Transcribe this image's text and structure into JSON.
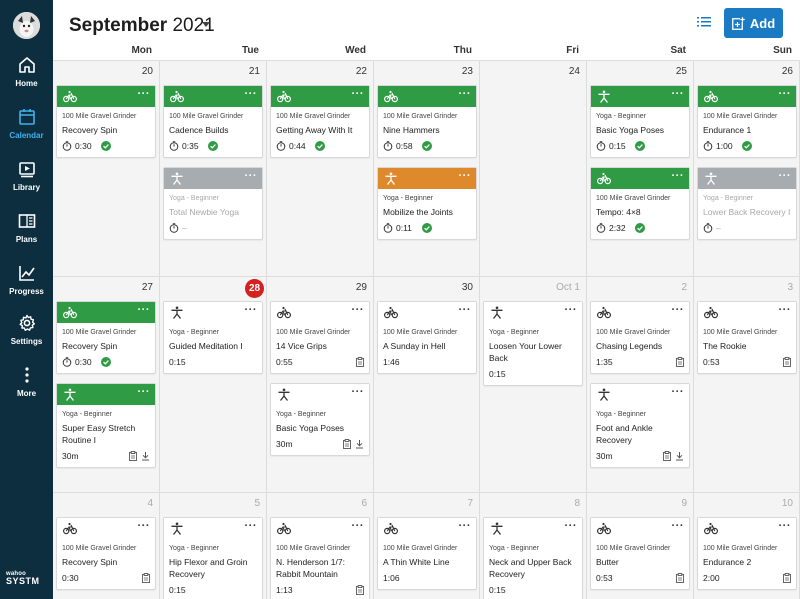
{
  "sidebar": {
    "nav": [
      {
        "label": "Home",
        "icon": "home-icon",
        "active": false
      },
      {
        "label": "Calendar",
        "icon": "calendar-icon",
        "active": true
      },
      {
        "label": "Library",
        "icon": "library-icon",
        "active": false
      },
      {
        "label": "Plans",
        "icon": "plans-icon",
        "active": false
      },
      {
        "label": "Progress",
        "icon": "progress-icon",
        "active": false
      },
      {
        "label": "Settings",
        "icon": "gear-icon",
        "active": false
      },
      {
        "label": "More",
        "icon": "more-icon",
        "active": false
      }
    ],
    "logo": {
      "line1": "wahoo",
      "line2": "SYSTM"
    }
  },
  "header": {
    "month": "September",
    "year": "2021",
    "add_label": "Add"
  },
  "weekdays": [
    "Mon",
    "Tue",
    "Wed",
    "Thu",
    "Fri",
    "Sat",
    "Sun"
  ],
  "colors": {
    "green": "#2f9b45",
    "gray": "#a6acaf",
    "orange": "#de8a2c",
    "accent": "#1b7ac4",
    "today": "#d4201e",
    "sidebar": "#0d2e3f"
  },
  "weeks": [
    [
      {
        "day": "20",
        "cards": [
          {
            "color": "green",
            "type": "bike",
            "sub": "100 Mile Gravel Grinder",
            "title": "Recovery Spin",
            "time": "0:30",
            "timer": true,
            "done": true
          }
        ]
      },
      {
        "day": "21",
        "cards": [
          {
            "color": "green",
            "type": "bike",
            "sub": "100 Mile Gravel Grinder",
            "title": "Cadence Builds",
            "time": "0:35",
            "timer": true,
            "done": true
          },
          {
            "color": "gray",
            "type": "yoga",
            "sub": "Yoga - Beginner",
            "title": "Total Newbie Yoga",
            "time": "–",
            "timer": true,
            "faded": true
          }
        ]
      },
      {
        "day": "22",
        "cards": [
          {
            "color": "green",
            "type": "bike",
            "sub": "100 Mile Gravel Grinder",
            "title": "Getting Away With It",
            "time": "0:44",
            "timer": true,
            "done": true
          }
        ]
      },
      {
        "day": "23",
        "cards": [
          {
            "color": "green",
            "type": "bike",
            "sub": "100 Mile Gravel Grinder",
            "title": "Nine Hammers",
            "time": "0:58",
            "timer": true,
            "done": true
          },
          {
            "color": "orange",
            "type": "yoga",
            "sub": "Yoga - Beginner",
            "title": "Mobilize the Joints",
            "time": "0:11",
            "timer": true,
            "done": true
          }
        ]
      },
      {
        "day": "24",
        "cards": []
      },
      {
        "day": "25",
        "cards": [
          {
            "color": "green",
            "type": "yoga",
            "sub": "Yoga - Beginner",
            "title": "Basic Yoga Poses",
            "time": "0:15",
            "timer": true,
            "done": true
          },
          {
            "color": "green",
            "type": "bike",
            "sub": "100 Mile Gravel Grinder",
            "title": "Tempo: 4×8",
            "time": "2:32",
            "timer": true,
            "done": true
          }
        ]
      },
      {
        "day": "26",
        "cards": [
          {
            "color": "green",
            "type": "bike",
            "sub": "100 Mile Gravel Grinder",
            "title": "Endurance 1",
            "time": "1:00",
            "timer": true,
            "done": true
          },
          {
            "color": "gray",
            "type": "yoga",
            "sub": "Yoga - Beginner",
            "title": "Lower Back Recovery I",
            "time": "–",
            "timer": true,
            "faded": true
          }
        ]
      }
    ],
    [
      {
        "day": "27",
        "cards": [
          {
            "color": "green",
            "type": "bike",
            "sub": "100 Mile Gravel Grinder",
            "title": "Recovery Spin",
            "time": "0:30",
            "timer": true,
            "done": true
          },
          {
            "color": "green",
            "type": "yoga",
            "sub": "Yoga - Beginner",
            "title": "Super Easy Stretch Routine I",
            "time": "30m",
            "clip": true,
            "download": true
          }
        ]
      },
      {
        "day": "28",
        "today": true,
        "cards": [
          {
            "color": "white",
            "type": "yoga",
            "sub": "Yoga - Beginner",
            "title": "Guided Meditation I",
            "time": "0:15"
          }
        ]
      },
      {
        "day": "29",
        "cards": [
          {
            "color": "white",
            "type": "bike",
            "sub": "100 Mile Gravel Grinder",
            "title": "14 Vice Grips",
            "time": "0:55",
            "clip": true
          },
          {
            "color": "white",
            "type": "yoga",
            "sub": "Yoga - Beginner",
            "title": "Basic Yoga Poses",
            "time": "30m",
            "clip": true,
            "download": true
          }
        ]
      },
      {
        "day": "30",
        "cards": [
          {
            "color": "white",
            "type": "bike",
            "sub": "100 Mile Gravel Grinder",
            "title": "A Sunday in Hell",
            "time": "1:46"
          }
        ]
      },
      {
        "day": "Oct 1",
        "muted": true,
        "cards": [
          {
            "color": "white",
            "type": "yoga",
            "sub": "Yoga - Beginner",
            "title": "Loosen Your Lower Back",
            "time": "0:15"
          }
        ]
      },
      {
        "day": "2",
        "muted": true,
        "cards": [
          {
            "color": "white",
            "type": "bike",
            "sub": "100 Mile Gravel Grinder",
            "title": "Chasing Legends",
            "time": "1:35",
            "clip": true
          },
          {
            "color": "white",
            "type": "yoga",
            "sub": "Yoga - Beginner",
            "title": "Foot and Ankle Recovery",
            "time": "30m",
            "clip": true,
            "download": true
          }
        ]
      },
      {
        "day": "3",
        "muted": true,
        "cards": [
          {
            "color": "white",
            "type": "bike",
            "sub": "100 Mile Gravel Grinder",
            "title": "The Rookie",
            "time": "0:53",
            "clip": true
          }
        ]
      }
    ],
    [
      {
        "day": "4",
        "muted": true,
        "cards": [
          {
            "color": "white",
            "type": "bike",
            "sub": "100 Mile Gravel Grinder",
            "title": "Recovery Spin",
            "time": "0:30",
            "clip": true
          }
        ]
      },
      {
        "day": "5",
        "muted": true,
        "cards": [
          {
            "color": "white",
            "type": "yoga",
            "sub": "Yoga - Beginner",
            "title": "Hip Flexor and Groin Recovery",
            "time": "0:15"
          }
        ]
      },
      {
        "day": "6",
        "muted": true,
        "cards": [
          {
            "color": "white",
            "type": "bike",
            "sub": "100 Mile Gravel Grinder",
            "title": "N. Henderson 1/7: Rabbit Mountain",
            "time": "1:13",
            "clip": true
          }
        ]
      },
      {
        "day": "7",
        "muted": true,
        "cards": [
          {
            "color": "white",
            "type": "bike",
            "sub": "100 Mile Gravel Grinder",
            "title": "A Thin White Line",
            "time": "1:06"
          }
        ]
      },
      {
        "day": "8",
        "muted": true,
        "cards": [
          {
            "color": "white",
            "type": "yoga",
            "sub": "Yoga - Beginner",
            "title": "Neck and Upper Back Recovery",
            "time": "0:15"
          }
        ]
      },
      {
        "day": "9",
        "muted": true,
        "cards": [
          {
            "color": "white",
            "type": "bike",
            "sub": "100 Mile Gravel Grinder",
            "title": "Butter",
            "time": "0:53",
            "clip": true
          }
        ]
      },
      {
        "day": "10",
        "muted": true,
        "cards": [
          {
            "color": "white",
            "type": "bike",
            "sub": "100 Mile Gravel Grinder",
            "title": "Endurance 2",
            "time": "2:00",
            "clip": true
          }
        ]
      }
    ]
  ]
}
